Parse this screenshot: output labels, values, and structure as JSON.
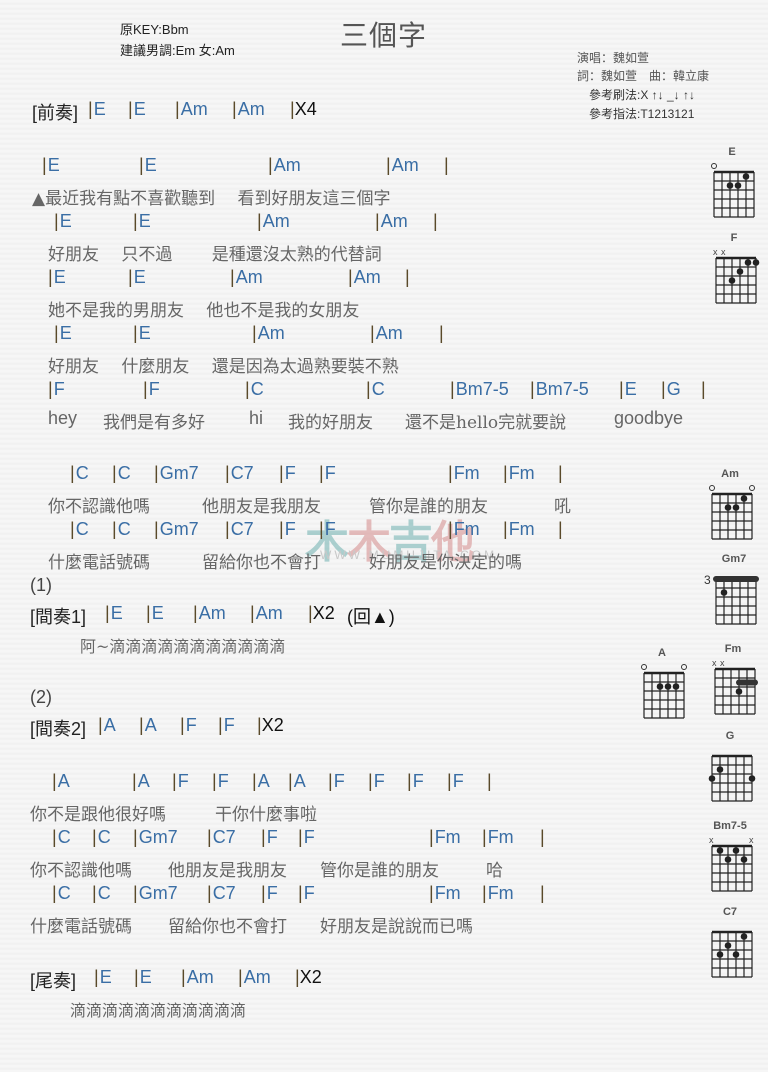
{
  "header": {
    "original_key": "原KEY:Bbm",
    "suggested_key": "建議男調:Em 女:Am",
    "title": "三個字",
    "singer": "演唱：魏如萱",
    "lyricist_composer": "詞：魏如萱　曲：韓立康",
    "strum_pattern": "參考刷法:X ↑↓ _↓ ↑↓",
    "finger_pattern": "參考指法:T1213121"
  },
  "watermark": {
    "text": [
      "木",
      "木",
      "吉",
      "他"
    ],
    "url": "WWW.MUMUJITA.COM"
  },
  "sections": {
    "intro": {
      "label": "[前奏]",
      "chords": [
        "E",
        "E",
        "Am",
        "Am"
      ],
      "repeat": "X4"
    },
    "v1": {
      "chords": [
        "E",
        "E",
        "Am",
        "Am"
      ],
      "lyric": "▲最近我有點不喜歡聽到　 看到好朋友這三個字"
    },
    "v2": {
      "chords": [
        "E",
        "E",
        "Am",
        "Am"
      ],
      "lyric": "好朋友　 只不過　　 是種還沒太熟的代替詞"
    },
    "v3": {
      "chords": [
        "E",
        "E",
        "Am",
        "Am"
      ],
      "lyric": "她不是我的男朋友　 他也不是我的女朋友"
    },
    "v4": {
      "chords": [
        "E",
        "E",
        "Am",
        "Am"
      ],
      "lyric": "好朋友　 什麼朋友　 還是因為太過熟要裝不熟"
    },
    "v5": {
      "chords": [
        "F",
        "F",
        "C",
        "C",
        "Bm7-5",
        "Bm7-5",
        "E",
        "G"
      ],
      "lyric": [
        "hey",
        "我們是有多好",
        "hi",
        "我的好朋友",
        "還不是hello完就要說",
        "goodbye"
      ]
    },
    "c1": {
      "chords": [
        "C",
        "C",
        "Gm7",
        "C7",
        "F",
        "F",
        "Fm",
        "Fm"
      ],
      "lyric": [
        "你不認識他嗎",
        "他朋友是我朋友",
        "管你是誰的朋友",
        "吼"
      ]
    },
    "c2": {
      "chords": [
        "C",
        "C",
        "Gm7",
        "C7",
        "F",
        "F",
        "Fm",
        "Fm"
      ],
      "lyric": [
        "什麼電話號碼",
        "留給你也不會打",
        "好朋友是你決定的嗎"
      ]
    },
    "mark1": "(1)",
    "inter1": {
      "label": "[間奏1]",
      "chords": [
        "E",
        "E",
        "Am",
        "Am"
      ],
      "repeat": "X2",
      "note": "(回▲)",
      "lyric": "阿~滴滴滴滴滴滴滴滴滴滴滴"
    },
    "mark2": "(2)",
    "inter2": {
      "label": "[間奏2]",
      "chords": [
        "A",
        "A",
        "F",
        "F"
      ],
      "repeat": "X2"
    },
    "b1": {
      "chords": [
        "A",
        "A",
        "F",
        "F",
        "A",
        "A",
        "F",
        "F",
        "F",
        "F"
      ],
      "lyric": [
        "你不是跟他很好嗎",
        "干你什麼事啦"
      ]
    },
    "b2": {
      "chords": [
        "C",
        "C",
        "Gm7",
        "C7",
        "F",
        "F",
        "Fm",
        "Fm"
      ],
      "lyric": [
        "你不認識他嗎",
        "他朋友是我朋友",
        "管你是誰的朋友",
        "哈"
      ]
    },
    "b3": {
      "chords": [
        "C",
        "C",
        "Gm7",
        "C7",
        "F",
        "F",
        "Fm",
        "Fm"
      ],
      "lyric": [
        "什麼電話號碼",
        "留給你也不會打",
        "好朋友是說說而已嗎"
      ]
    },
    "outro": {
      "label": "[尾奏]",
      "chords": [
        "E",
        "E",
        "Am",
        "Am"
      ],
      "repeat": "X2",
      "lyric": "滴滴滴滴滴滴滴滴滴滴滴"
    }
  },
  "chord_diagrams": [
    {
      "name": "E"
    },
    {
      "name": "F"
    },
    {
      "name": "Am"
    },
    {
      "name": "Gm7",
      "fret": "3"
    },
    {
      "name": "A"
    },
    {
      "name": "Fm"
    },
    {
      "name": "G"
    },
    {
      "name": "Bm7-5"
    },
    {
      "name": "C7"
    }
  ]
}
